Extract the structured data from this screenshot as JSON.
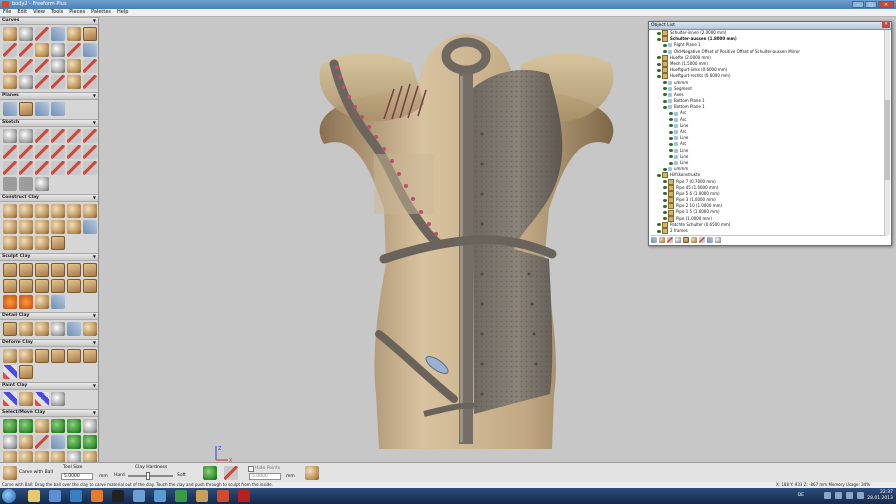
{
  "window": {
    "title": "body2 - Freeform Plus",
    "buttons": [
      "–",
      "□",
      "✕"
    ]
  },
  "menu": [
    "File",
    "Edit",
    "View",
    "Tools",
    "Pieces",
    "Palettes",
    "Help"
  ],
  "palettes": [
    {
      "title": "Curves",
      "tools": [
        "a",
        "b",
        "c",
        "d",
        "a",
        "f",
        "c",
        "c",
        "a",
        "b",
        "c",
        "d",
        "a",
        "c",
        "c",
        "b",
        "a",
        "c",
        "a",
        "b",
        "c",
        "c",
        "a",
        "c"
      ]
    },
    {
      "title": "Planes",
      "tools": [
        "d",
        "f",
        "d",
        "d"
      ]
    },
    {
      "title": "Sketch",
      "tools": [
        "b",
        "b",
        "c",
        "c",
        "c",
        "c",
        "c",
        "c",
        "c",
        "c",
        "c",
        "c",
        "c",
        "c",
        "c",
        "c",
        "c",
        "c",
        "i",
        "i",
        "b"
      ]
    },
    {
      "title": "Construct Clay",
      "tools": [
        "a",
        "a",
        "a",
        "a",
        "a",
        "a",
        "a",
        "a",
        "a",
        "a",
        "a",
        "d",
        "a",
        "a",
        "a",
        "f"
      ]
    },
    {
      "title": "Sculpt Clay",
      "tools": [
        "f",
        "f",
        "f",
        "f",
        "f",
        "f",
        "f",
        "f",
        "f",
        "f",
        "f",
        "f",
        "g",
        "g",
        "a",
        "d"
      ]
    },
    {
      "title": "Detail Clay",
      "tools": [
        "f",
        "a",
        "a",
        "b",
        "d",
        "a"
      ]
    },
    {
      "title": "Deform Clay",
      "tools": [
        "a",
        "a",
        "f",
        "f",
        "f",
        "f",
        "h",
        "f"
      ]
    },
    {
      "title": "Paint Clay",
      "tools": [
        "h",
        "a",
        "h",
        "b"
      ]
    },
    {
      "title": "Select/Move Clay",
      "tools": [
        "e",
        "e",
        "a",
        "e",
        "e",
        "b",
        "b",
        "a",
        "c",
        "d",
        "e",
        "e",
        "a",
        "a",
        "a",
        "a",
        "b",
        "a"
      ]
    }
  ],
  "object_list": {
    "title": "Object List",
    "rows": [
      {
        "indent": 1,
        "label": "Schulter-innen (2.0000 mm)",
        "icon": "folder",
        "bold": false
      },
      {
        "indent": 1,
        "label": "Schulter-aussen (1.8000 mm)",
        "icon": "folder",
        "bold": true
      },
      {
        "indent": 2,
        "label": "Right Plane 1",
        "icon": "curve",
        "bold": false
      },
      {
        "indent": 2,
        "label": "Old-Negative Offset of Positive Offset of Schulter-aussen Mirror",
        "icon": "curve",
        "bold": false
      },
      {
        "indent": 1,
        "label": "Huefte (2.0000 mm)",
        "icon": "folder",
        "bold": false
      },
      {
        "indent": 1,
        "label": "Mesh (1.5000 mm)",
        "icon": "folder",
        "bold": false
      },
      {
        "indent": 1,
        "label": "Hueftgurt-links (0.6000 mm)",
        "icon": "folder",
        "bold": false
      },
      {
        "indent": 1,
        "label": "Hueftgurt-rechts (0.6000 mm)",
        "icon": "folder",
        "bold": false
      },
      {
        "indent": 2,
        "label": "ummm",
        "icon": "curve",
        "bold": false
      },
      {
        "indent": 2,
        "label": "Segment",
        "icon": "curve",
        "bold": false
      },
      {
        "indent": 2,
        "label": "Axes",
        "icon": "curve",
        "bold": false
      },
      {
        "indent": 2,
        "label": "Bottom Plane 1",
        "icon": "curve",
        "bold": false
      },
      {
        "indent": 2,
        "label": "Bottom Plane 1",
        "icon": "curve",
        "bold": false
      },
      {
        "indent": 3,
        "label": "Arc",
        "icon": "curve",
        "bold": false
      },
      {
        "indent": 3,
        "label": "Arc",
        "icon": "curve",
        "bold": false
      },
      {
        "indent": 3,
        "label": "Line",
        "icon": "curve",
        "bold": false
      },
      {
        "indent": 3,
        "label": "Arc",
        "icon": "curve",
        "bold": false
      },
      {
        "indent": 3,
        "label": "Line",
        "icon": "curve",
        "bold": false
      },
      {
        "indent": 3,
        "label": "Arc",
        "icon": "curve",
        "bold": false
      },
      {
        "indent": 3,
        "label": "Line",
        "icon": "curve",
        "bold": false
      },
      {
        "indent": 3,
        "label": "Line",
        "icon": "curve",
        "bold": false
      },
      {
        "indent": 3,
        "label": "Line",
        "icon": "curve",
        "bold": false
      },
      {
        "indent": 2,
        "label": "ummm",
        "icon": "curve",
        "bold": false
      },
      {
        "indent": 1,
        "label": "Hilfskonstrukte",
        "icon": "folder",
        "bold": false
      },
      {
        "indent": 2,
        "label": "Pipe 7 (0.7000 mm)",
        "icon": "folder",
        "bold": false
      },
      {
        "indent": 2,
        "label": "Pipe 45 (1.0000 mm)",
        "icon": "folder",
        "bold": false
      },
      {
        "indent": 2,
        "label": "Pipe 5 6 (1.0000 mm)",
        "icon": "folder",
        "bold": false
      },
      {
        "indent": 2,
        "label": "Pipe 3 (1.0000 mm)",
        "icon": "folder",
        "bold": false
      },
      {
        "indent": 2,
        "label": "Pipe 2 10 (1.0000 mm)",
        "icon": "folder",
        "bold": false
      },
      {
        "indent": 2,
        "label": "Pipe 1 5 (1.0000 mm)",
        "icon": "folder",
        "bold": false
      },
      {
        "indent": 2,
        "label": "Pipe (1.0000 mm)",
        "icon": "folder",
        "bold": false
      },
      {
        "indent": 1,
        "label": "Patchte Schulter (0.6500 mm)",
        "icon": "folder",
        "bold": false
      },
      {
        "indent": 1,
        "label": "2 frames",
        "icon": "folder",
        "bold": false
      }
    ]
  },
  "statusbar": {
    "tool_name": "Carve with Ball",
    "tool_size_label": "Tool Size",
    "tool_size_value": "5.0000",
    "tool_size_unit": "mm",
    "hardness_label": "Clay Hardness",
    "hard_label": "Hard",
    "soft_label": "Soft",
    "hardness": 0.45,
    "hide_points_label": "Hide Points",
    "depth_value": "5.0000",
    "depth_unit": "mm"
  },
  "hint": {
    "left": "Carve with Ball: Drag the ball over the clay to carve material out of the clay. Touch the clay and push through to sculpt from the inside.",
    "right": "X: 188   Y: 933   Z: -867   mm   Memory Usage: 34%"
  },
  "taskbar": {
    "lang": "DE",
    "time": "22:37",
    "date": "28.01.2013"
  },
  "axes": {
    "z": "Z",
    "x": "X"
  }
}
